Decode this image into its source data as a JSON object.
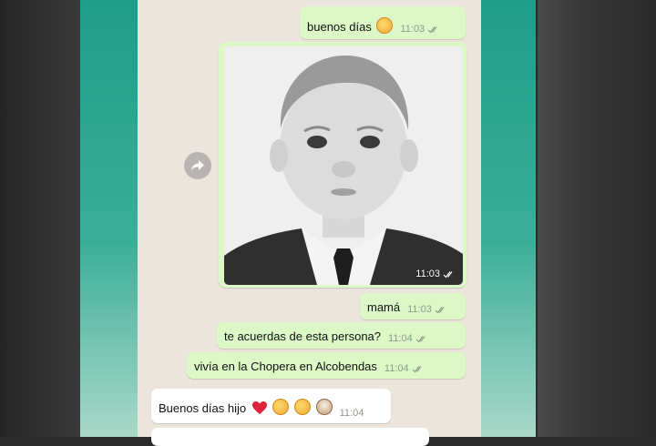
{
  "chat": {
    "messages": [
      {
        "text": "buenos días",
        "time": "11:03"
      },
      {
        "time": "11:03"
      },
      {
        "text": "mamá",
        "time": "11:03"
      },
      {
        "text": "te acuerdas de esta persona?",
        "time": "11:04"
      },
      {
        "text": "vivía en la Chopera en Alcobendas",
        "time": "11:04"
      },
      {
        "text": "Buenos días hijo",
        "time": "11:04"
      }
    ]
  },
  "icons": {
    "forward": "forward-arrow-icon",
    "read_ticks": "double-check-icon",
    "emoji": [
      "kissing-face-emoji",
      "red-heart-emoji",
      "hugging-face-emoji",
      "dog-face-emoji"
    ]
  },
  "colors": {
    "outgoing_bubble": "#dcf8c6",
    "incoming_bubble": "#ffffff",
    "chat_background": "#ece5dd",
    "side_teal": "#1f9d8a",
    "heart": "#e0233a"
  }
}
